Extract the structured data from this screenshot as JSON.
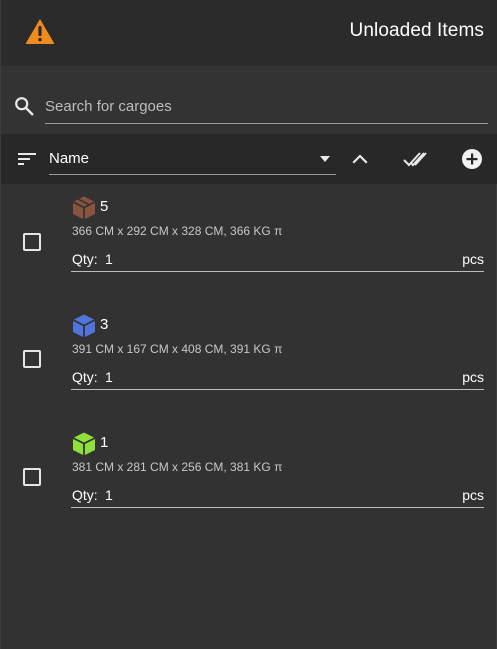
{
  "header": {
    "title": "Unloaded Items",
    "warning_icon": "warning-triangle-icon",
    "warning_color": "#f08c1e"
  },
  "search": {
    "placeholder": "Search for cargoes",
    "value": ""
  },
  "toolbar": {
    "sort_field": "Name",
    "icons": [
      "sort-lines-icon",
      "chevron-down-icon",
      "chevron-up-icon",
      "double-check-icon",
      "add-circle-icon"
    ]
  },
  "items": [
    {
      "name": "5",
      "dims": "366 CM x 292 CM x 328 CM, 366 KG π",
      "qty_label": "Qty:",
      "qty": "1",
      "unit": "pcs",
      "color": "#8a5340",
      "checked": false
    },
    {
      "name": "3",
      "dims": "391 CM x 167 CM x 408 CM, 391 KG π",
      "qty_label": "Qty:",
      "qty": "1",
      "unit": "pcs",
      "color": "#5173dc",
      "checked": false
    },
    {
      "name": "1",
      "dims": "381 CM x 281 CM x 256 CM, 381 KG π",
      "qty_label": "Qty:",
      "qty": "1",
      "unit": "pcs",
      "color": "#8ee03a",
      "checked": false
    }
  ]
}
